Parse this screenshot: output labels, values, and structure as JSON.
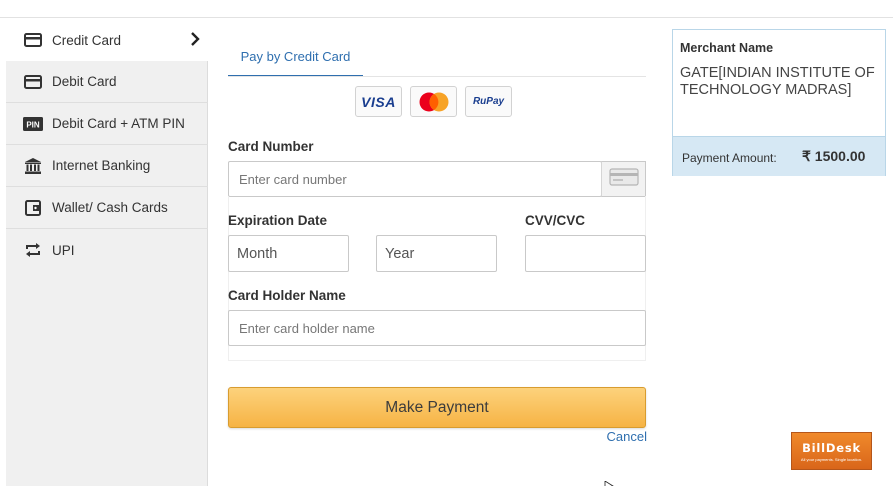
{
  "sidebar": {
    "items": [
      {
        "label": "Credit Card",
        "icon": "credit-card-icon",
        "active": true
      },
      {
        "label": "Debit Card",
        "icon": "debit-card-icon"
      },
      {
        "label": "Debit Card + ATM PIN",
        "icon": "pin-icon",
        "icon_text": "PIN"
      },
      {
        "label": "Internet Banking",
        "icon": "bank-icon"
      },
      {
        "label": "Wallet/ Cash Cards",
        "icon": "wallet-icon"
      },
      {
        "label": "UPI",
        "icon": "upi-transfer-icon"
      }
    ]
  },
  "tab": {
    "label": "Pay by Credit Card"
  },
  "card_brands": [
    "VISA",
    "Mastercard",
    "RuPay"
  ],
  "form": {
    "card_number_label": "Card Number",
    "card_number_placeholder": "Enter card number",
    "expiration_label": "Expiration Date",
    "month_value": "Month",
    "year_value": "Year",
    "cvv_label": "CVV/CVC",
    "holder_label": "Card Holder Name",
    "holder_placeholder": "Enter card holder name",
    "pay_button": "Make Payment",
    "cancel_link": "Cancel"
  },
  "merchant": {
    "heading": "Merchant Name",
    "name": "GATE[INDIAN INSTITUTE OF TECHNOLOGY MADRAS]",
    "amount_label": "Payment Amount:",
    "amount": "₹ 1500.00"
  },
  "branding": {
    "name": "BillDesk",
    "tagline": "All your payments. Single location."
  },
  "colors": {
    "accent": "#2f6faf",
    "button": "#f6b344",
    "sidebar_bg": "#f0f0f0",
    "merchant_footer": "#d6e8f4",
    "billdesk_orange": "#e5761f"
  }
}
